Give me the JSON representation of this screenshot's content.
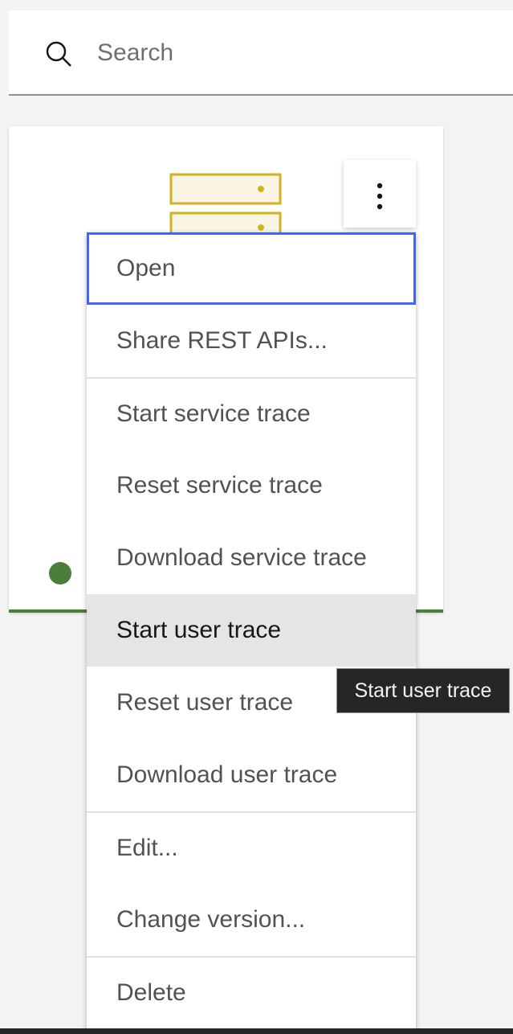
{
  "search": {
    "placeholder": "Search",
    "value": "",
    "icon": "search-icon"
  },
  "card": {
    "icon": "server-icon",
    "accent_color": "#4b7e3a",
    "status": {
      "color": "#4b7e3a",
      "state": "running"
    },
    "overflow_icon": "overflow-menu-vertical-icon"
  },
  "menu": {
    "items": [
      {
        "label": "Open",
        "state": "focused"
      },
      {
        "label": "Share REST APIs..."
      },
      {
        "label": "Start service trace",
        "divider_before": true
      },
      {
        "label": "Reset service trace"
      },
      {
        "label": "Download service trace"
      },
      {
        "label": "Start user trace",
        "state": "hover"
      },
      {
        "label": "Reset user trace"
      },
      {
        "label": "Download user trace"
      },
      {
        "label": "Edit...",
        "divider_before": true
      },
      {
        "label": "Change version..."
      },
      {
        "label": "Delete",
        "divider_before": true
      }
    ]
  },
  "tooltip": {
    "text": "Start user trace"
  },
  "colors": {
    "focus": "#4166f5",
    "hover_bg": "#e5e5e5",
    "tile_icon": "#d4b21f"
  }
}
